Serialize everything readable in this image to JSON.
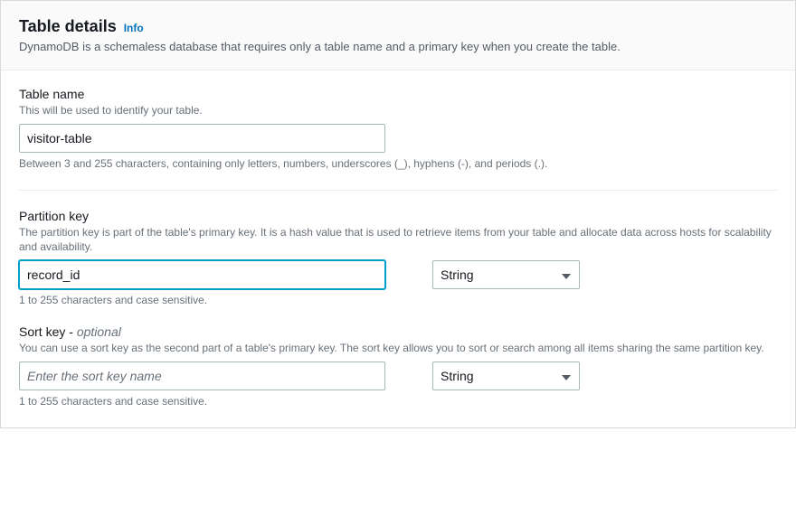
{
  "header": {
    "title": "Table details",
    "info_label": "Info",
    "subtitle": "DynamoDB is a schemaless database that requires only a table name and a primary key when you create the table."
  },
  "table_name": {
    "label": "Table name",
    "description": "This will be used to identify your table.",
    "value": "visitor-table",
    "hint": "Between 3 and 255 characters, containing only letters, numbers, underscores (_), hyphens (-), and periods (.)."
  },
  "partition_key": {
    "label": "Partition key",
    "description": "The partition key is part of the table's primary key. It is a hash value that is used to retrieve items from your table and allocate data across hosts for scalability and availability.",
    "value": "record_id",
    "type_value": "String",
    "hint": "1 to 255 characters and case sensitive."
  },
  "sort_key": {
    "label": "Sort key",
    "optional_suffix": "optional",
    "description": "You can use a sort key as the second part of a table's primary key. The sort key allows you to sort or search among all items sharing the same partition key.",
    "value": "",
    "placeholder": "Enter the sort key name",
    "type_value": "String",
    "hint": "1 to 255 characters and case sensitive."
  }
}
